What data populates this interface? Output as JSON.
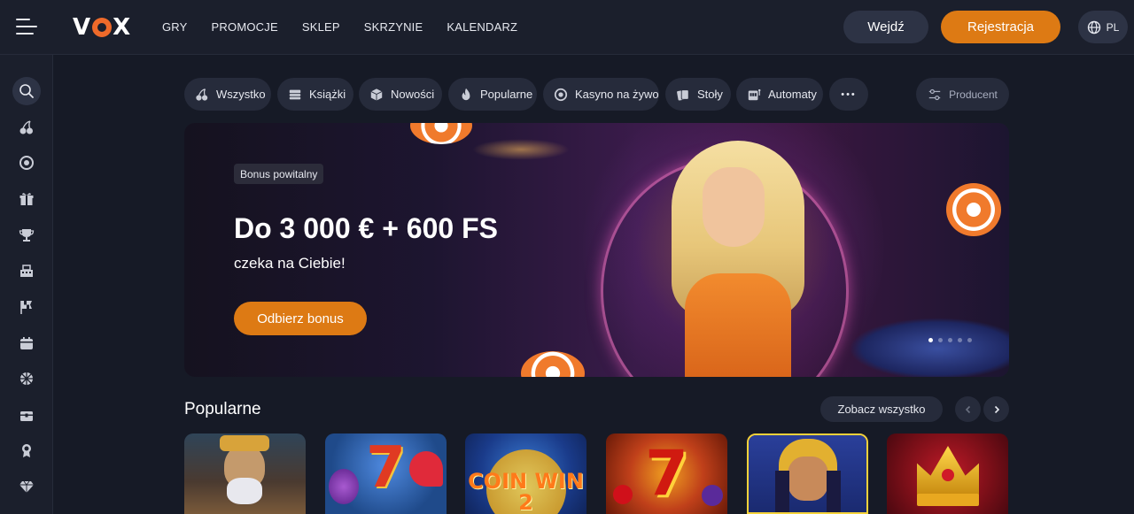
{
  "header": {
    "logo_text": "VOX",
    "nav": [
      "GRY",
      "PROMOCJE",
      "SKLEP",
      "SKRZYNIE",
      "KALENDARZ"
    ],
    "login_label": "Wejdź",
    "register_label": "Rejestracja",
    "language": "PL",
    "accent_color": "#dd7a14"
  },
  "sidebar": {
    "icons": [
      "search-icon",
      "cherries-icon",
      "roulette-icon",
      "gift-icon",
      "trophy-icon",
      "cashier-icon",
      "race-flag-icon",
      "calendar-icon",
      "wheel-icon",
      "chest-icon",
      "medal-icon",
      "diamond-icon"
    ]
  },
  "categories": [
    {
      "label": "Wszystko",
      "icon": "cherries-icon"
    },
    {
      "label": "Książki",
      "icon": "book-icon"
    },
    {
      "label": "Nowości",
      "icon": "cube-icon"
    },
    {
      "label": "Popularne",
      "icon": "flame-icon"
    },
    {
      "label": "Kasyno na żywo",
      "icon": "roulette-icon"
    },
    {
      "label": "Stoły",
      "icon": "cards-icon"
    },
    {
      "label": "Automaty",
      "icon": "slot-machine-icon"
    }
  ],
  "more_label": "•••",
  "producer_label": "Producent",
  "banner": {
    "badge": "Bonus powitalny",
    "headline": "Do 3 000 € + 600 FS",
    "subtitle": "czeka na Ciebie!",
    "cta": "Odbierz bonus",
    "slide_count": 5,
    "active_slide": 1
  },
  "popular": {
    "title": "Popularne",
    "see_all": "Zobacz wszystko",
    "games": [
      {
        "name": "pirate-game",
        "bg": "#2a3a4a",
        "glyph": ""
      },
      {
        "name": "super-7-fruits-game",
        "bg": "#1f4a8a",
        "glyph": "7"
      },
      {
        "name": "coin-win-2-game",
        "bg": "#1a3b8a",
        "glyph": "COIN WIN 2"
      },
      {
        "name": "hot-7-game",
        "bg": "#9a2a10",
        "glyph": "7"
      },
      {
        "name": "cleopatra-game",
        "bg": "#1f2f7a",
        "glyph": ""
      },
      {
        "name": "royal-crown-game",
        "bg": "#7a0f18",
        "glyph": ""
      }
    ]
  }
}
